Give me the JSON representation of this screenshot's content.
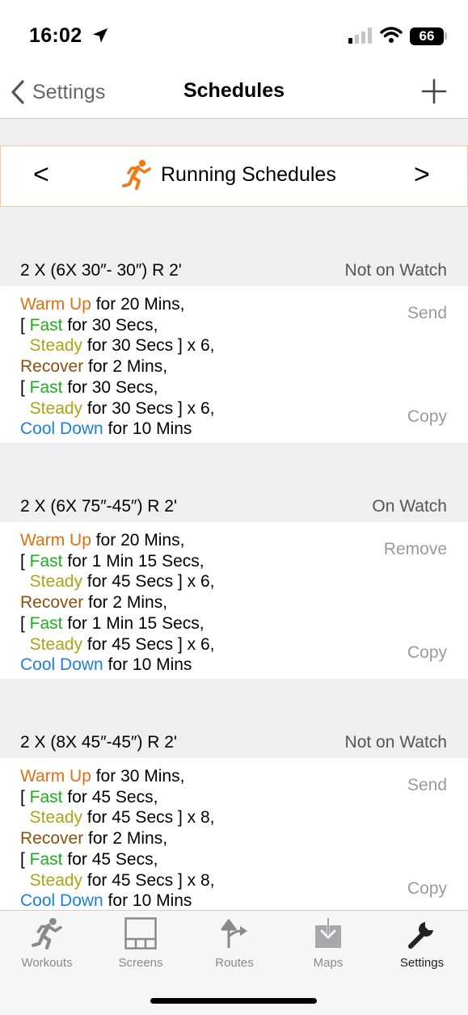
{
  "status_bar": {
    "time": "16:02",
    "battery": "66"
  },
  "nav": {
    "back_label": "Settings",
    "title": "Schedules"
  },
  "selector": {
    "prev": "<",
    "next": ">",
    "title": "Running Schedules",
    "icon": "runner-icon"
  },
  "colors": {
    "warm_up": "#e07010",
    "fast": "#1db01d",
    "steady": "#a9a514",
    "recover": "#8a5010",
    "cool_down": "#1b7fe0"
  },
  "schedules": [
    {
      "name": "2 X (6X 30″- 30″) R 2'",
      "status": "Not on Watch",
      "action_top": "Send",
      "action_bottom": "Copy",
      "steps": [
        {
          "prefix": "",
          "kw": "Warm Up",
          "rest": " for 20 Mins,",
          "kind": "warm"
        },
        {
          "prefix": "[ ",
          "kw": "Fast",
          "rest": " for 30 Secs,",
          "kind": "fast"
        },
        {
          "prefix": "  ",
          "kw": "Steady",
          "rest": " for 30 Secs ] x 6,",
          "kind": "steady"
        },
        {
          "prefix": "",
          "kw": "Recover",
          "rest": " for 2 Mins,",
          "kind": "rec"
        },
        {
          "prefix": "[ ",
          "kw": "Fast",
          "rest": " for 30 Secs,",
          "kind": "fast"
        },
        {
          "prefix": "  ",
          "kw": "Steady",
          "rest": " for 30 Secs ] x 6,",
          "kind": "steady"
        },
        {
          "prefix": "",
          "kw": "Cool Down",
          "rest": " for 10 Mins",
          "kind": "cool"
        }
      ]
    },
    {
      "name": "2 X (6X 75″-45″) R 2'",
      "status": "On Watch",
      "action_top": "Remove",
      "action_bottom": "Copy",
      "steps": [
        {
          "prefix": "",
          "kw": "Warm Up",
          "rest": " for 20 Mins,",
          "kind": "warm"
        },
        {
          "prefix": "[ ",
          "kw": "Fast",
          "rest": " for 1 Min 15 Secs,",
          "kind": "fast"
        },
        {
          "prefix": "  ",
          "kw": "Steady",
          "rest": " for 45 Secs ] x 6,",
          "kind": "steady"
        },
        {
          "prefix": "",
          "kw": "Recover",
          "rest": " for 2 Mins,",
          "kind": "rec"
        },
        {
          "prefix": "[ ",
          "kw": "Fast",
          "rest": " for 1 Min 15 Secs,",
          "kind": "fast"
        },
        {
          "prefix": "  ",
          "kw": "Steady",
          "rest": " for 45 Secs ] x 6,",
          "kind": "steady"
        },
        {
          "prefix": "",
          "kw": "Cool Down",
          "rest": " for 10 Mins",
          "kind": "cool"
        }
      ]
    },
    {
      "name": "2 X (8X 45″-45″) R 2'",
      "status": "Not on Watch",
      "action_top": "Send",
      "action_bottom": "Copy",
      "steps": [
        {
          "prefix": "",
          "kw": "Warm Up",
          "rest": " for 30 Mins,",
          "kind": "warm"
        },
        {
          "prefix": "[ ",
          "kw": "Fast",
          "rest": " for 45 Secs,",
          "kind": "fast"
        },
        {
          "prefix": "  ",
          "kw": "Steady",
          "rest": " for 45 Secs ] x 8,",
          "kind": "steady"
        },
        {
          "prefix": "",
          "kw": "Recover",
          "rest": " for 2 Mins,",
          "kind": "rec"
        },
        {
          "prefix": "[ ",
          "kw": "Fast",
          "rest": " for 45 Secs,",
          "kind": "fast"
        },
        {
          "prefix": "  ",
          "kw": "Steady",
          "rest": " for 45 Secs ] x 8,",
          "kind": "steady"
        },
        {
          "prefix": "",
          "kw": "Cool Down",
          "rest": " for 10 Mins",
          "kind": "cool"
        }
      ]
    }
  ],
  "tabs": [
    {
      "label": "Workouts",
      "icon": "runner-icon",
      "active": false
    },
    {
      "label": "Screens",
      "icon": "screens-grid-icon",
      "active": false
    },
    {
      "label": "Routes",
      "icon": "route-arrow-icon",
      "active": false
    },
    {
      "label": "Maps",
      "icon": "download-map-icon",
      "active": false
    },
    {
      "label": "Settings",
      "icon": "wrench-icon",
      "active": true
    }
  ]
}
